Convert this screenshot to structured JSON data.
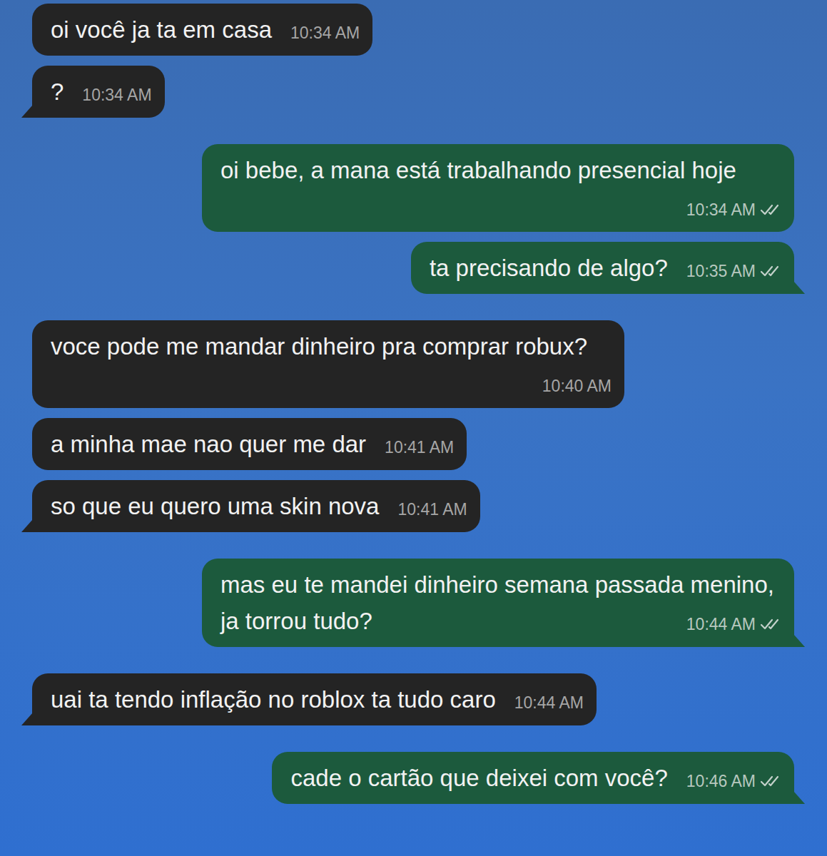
{
  "chat": {
    "messages": [
      {
        "kind": "incoming",
        "text": "oi você ja ta em casa",
        "time": "10:34 AM",
        "tail": false
      },
      {
        "kind": "incoming",
        "text": "?",
        "time": "10:34 AM",
        "tail": true
      },
      {
        "kind": "outgoing",
        "text": "oi bebe, a mana está trabalhando presencial hoje",
        "time": "10:34 AM",
        "tail": false,
        "status": "delivered"
      },
      {
        "kind": "outgoing",
        "text": "ta precisando de algo?",
        "time": "10:35 AM",
        "tail": true,
        "status": "delivered"
      },
      {
        "kind": "incoming",
        "text": "voce pode me mandar dinheiro pra comprar robux?",
        "time": "10:40 AM",
        "tail": false
      },
      {
        "kind": "incoming",
        "text": "a minha mae nao quer me dar",
        "time": "10:41 AM",
        "tail": false
      },
      {
        "kind": "incoming",
        "text": "so que eu quero uma skin nova",
        "time": "10:41 AM",
        "tail": true
      },
      {
        "kind": "outgoing",
        "text": "mas eu te mandei dinheiro semana passada menino, ja torrou tudo?",
        "time": "10:44 AM",
        "tail": true,
        "status": "delivered"
      },
      {
        "kind": "incoming",
        "text": "uai ta tendo inflação no roblox ta tudo caro",
        "time": "10:44 AM",
        "tail": true
      },
      {
        "kind": "outgoing",
        "text": "cade o cartão que deixei com você?",
        "time": "10:46 AM",
        "tail": true,
        "status": "delivered"
      }
    ]
  }
}
